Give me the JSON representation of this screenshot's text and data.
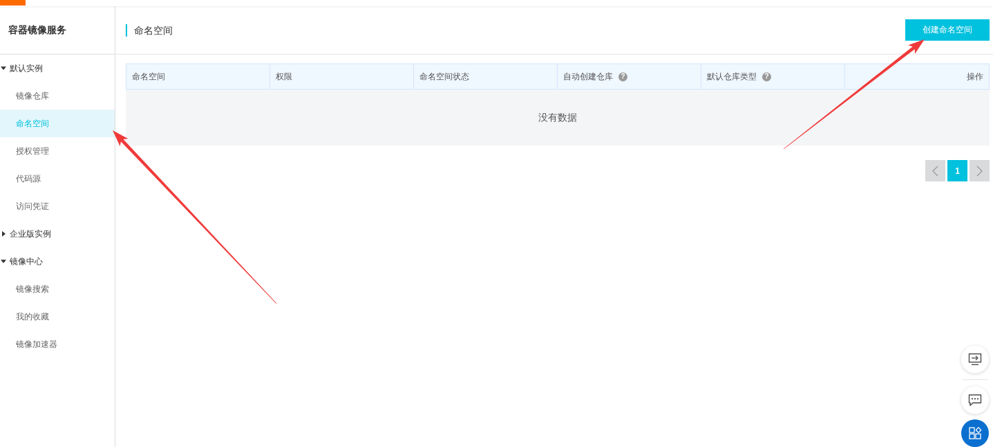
{
  "sidebar": {
    "title": "容器镜像服务",
    "groups": [
      {
        "label": "默认实例",
        "expanded": true,
        "children": [
          {
            "label": "镜像仓库",
            "selected": false
          },
          {
            "label": "命名空间",
            "selected": true
          },
          {
            "label": "授权管理",
            "selected": false
          },
          {
            "label": "代码源",
            "selected": false
          },
          {
            "label": "访问凭证",
            "selected": false
          }
        ]
      },
      {
        "label": "企业版实例",
        "expanded": false
      },
      {
        "label": "镜像中心",
        "expanded": true,
        "children": [
          {
            "label": "镜像搜索",
            "selected": false
          },
          {
            "label": "我的收藏",
            "selected": false
          },
          {
            "label": "镜像加速器",
            "selected": false
          }
        ]
      }
    ]
  },
  "header": {
    "title": "命名空间",
    "create_button": "创建命名空间"
  },
  "table": {
    "columns": [
      {
        "label": "命名空间"
      },
      {
        "label": "权限"
      },
      {
        "label": "命名空间状态"
      },
      {
        "label": "自动创建仓库",
        "hint": "?"
      },
      {
        "label": "默认仓库类型",
        "hint": "?"
      },
      {
        "label": "操作"
      }
    ],
    "empty_text": "没有数据"
  },
  "pagination": {
    "pages": [
      {
        "label": "1",
        "selected": true
      }
    ]
  },
  "float_tools": [
    {
      "kind": "screen"
    },
    {
      "kind": "chat"
    },
    {
      "kind": "apps"
    }
  ],
  "annotations": [
    {
      "kind": "arrow"
    },
    {
      "kind": "arrow"
    }
  ]
}
